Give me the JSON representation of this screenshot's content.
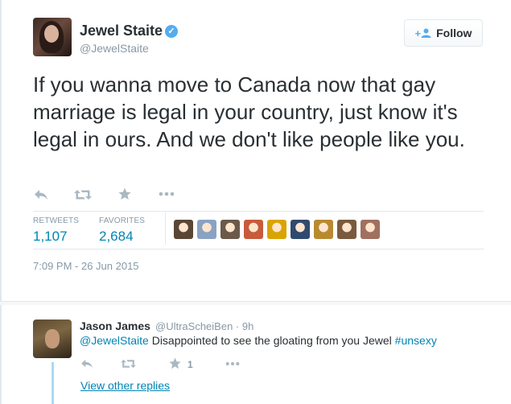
{
  "tweet": {
    "author_name": "Jewel Staite",
    "author_handle": "@JewelStaite",
    "verified_glyph": "✓",
    "follow_label": "Follow",
    "follow_icon": "+👤",
    "text": "If you wanna move to Canada now that gay marriage is legal in your country, just know it's legal in ours. And we don't like people like you.",
    "stats": {
      "retweets_label": "RETWEETS",
      "retweets_value": "1,107",
      "favorites_label": "FAVORITES",
      "favorites_value": "2,684"
    },
    "timestamp": "7:09 PM - 26 Jun 2015",
    "icons": [
      "reply-icon",
      "retweet-icon",
      "favorite-icon",
      "more-icon"
    ],
    "favoriter_colors": [
      "#5a4635",
      "#8aa2c2",
      "#6b5a4a",
      "#c75b3b",
      "#d9a400",
      "#304a6e",
      "#b88a30",
      "#7a5a3e",
      "#a07060"
    ]
  },
  "reply": {
    "author_name": "Jason James",
    "author_handle": "@UltraScheiBen · 9h",
    "mention": "@JewelStaite",
    "text": " Disappointed to see the gloating from you Jewel ",
    "hashtag": "#unsexy",
    "favorite_count": "1",
    "view_more_label": "View other replies"
  },
  "colors": {
    "accent": "#55acee",
    "link": "#0084b4",
    "muted": "#8899a6",
    "border": "#e1e8ed"
  }
}
